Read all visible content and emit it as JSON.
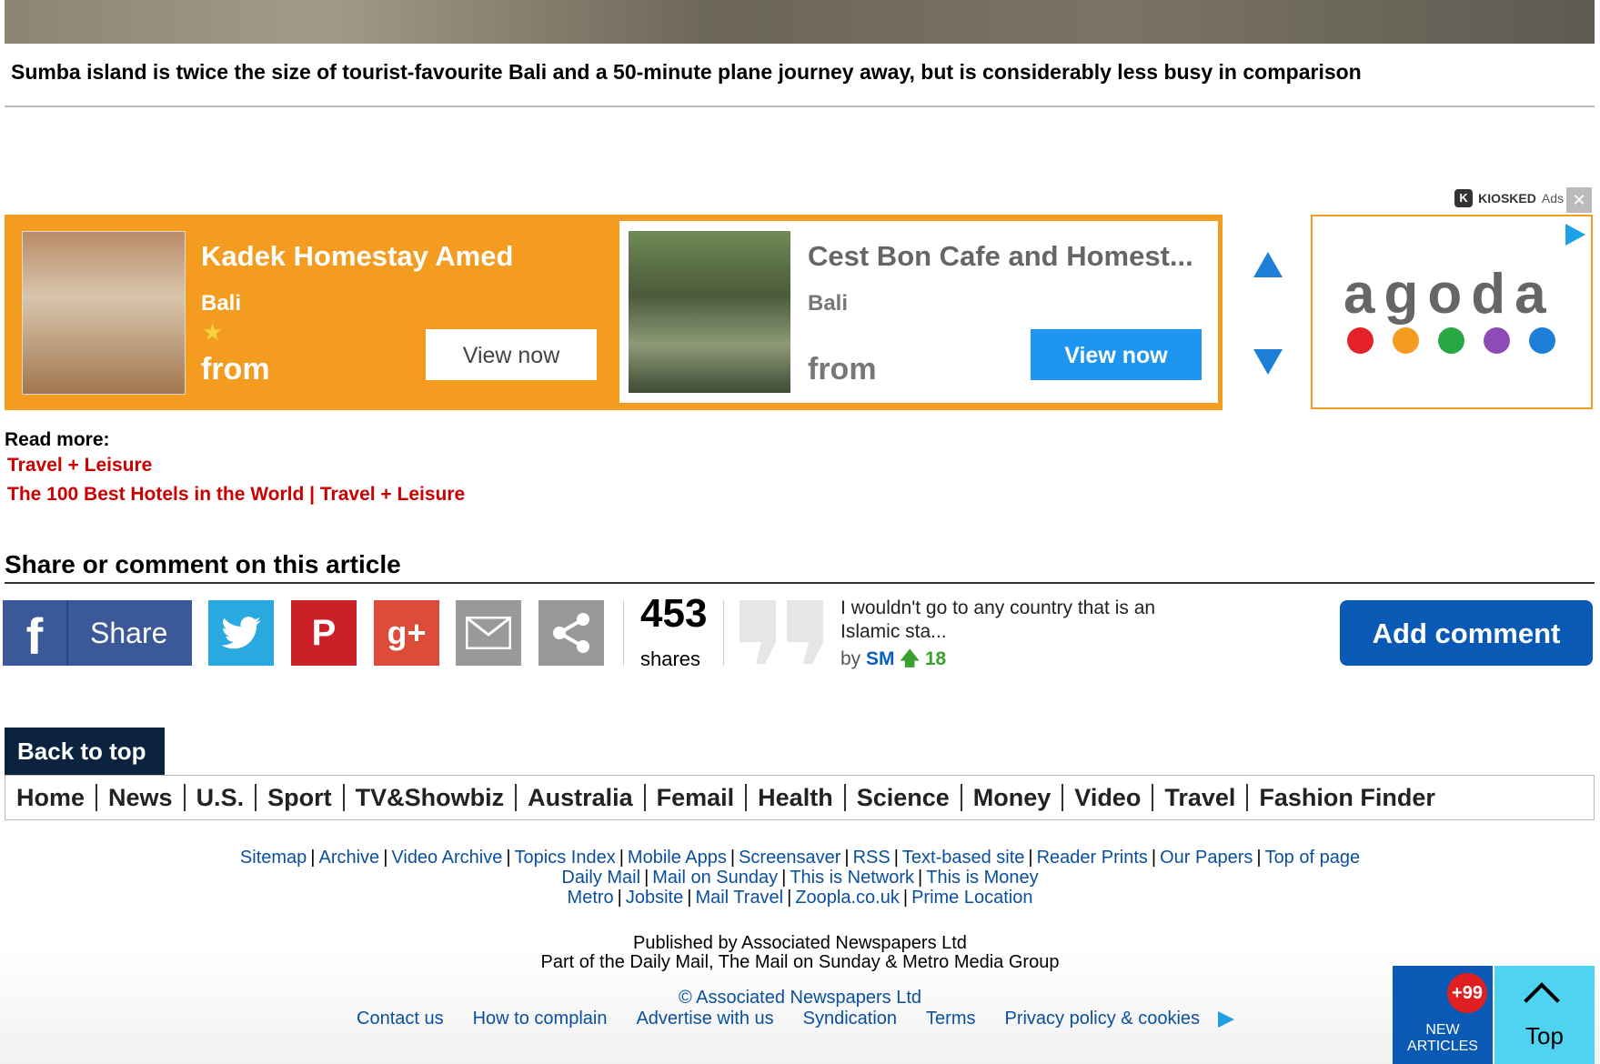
{
  "caption": "Sumba island is twice the size of tourist-favourite Bali and a 50-minute plane journey away, but is considerably less busy in comparison",
  "ad": {
    "provider": "KIOSKED",
    "ads_label": "Ads",
    "close": "✕",
    "cards": [
      {
        "title": "Kadek Homestay Amed",
        "location": "Bali",
        "stars": "★",
        "from": "from",
        "button": "View now"
      },
      {
        "title": "Cest Bon Cafe and Homest...",
        "location": "Bali",
        "from": "from",
        "button": "View now"
      }
    ],
    "brand": "agoda",
    "brand_dot_colors": [
      "#e52128",
      "#f39c1f",
      "#28a745",
      "#8e4bb5",
      "#1e7fd8"
    ]
  },
  "read_more": {
    "label": "Read more:",
    "links": [
      "Travel + Leisure",
      "The 100 Best Hotels in the World | Travel + Leisure"
    ]
  },
  "share": {
    "title": "Share or comment on this article",
    "facebook_label": "Share",
    "count": "453",
    "count_label": "shares",
    "top_comment": "I wouldn't go to any country that is an Islamic sta...",
    "comment_by_prefix": "by",
    "comment_author": "SM",
    "comment_score": "18",
    "add_comment": "Add comment"
  },
  "back_to_top": "Back to top",
  "main_nav": [
    "Home",
    "News",
    "U.S.",
    "Sport",
    "TV&Showbiz",
    "Australia",
    "Femail",
    "Health",
    "Science",
    "Money",
    "Video",
    "Travel",
    "Fashion Finder"
  ],
  "footer": {
    "row1": [
      "Sitemap",
      "Archive",
      "Video Archive",
      "Topics Index",
      "Mobile Apps",
      "Screensaver",
      "RSS",
      "Text-based site",
      "Reader Prints",
      "Our Papers",
      "Top of page"
    ],
    "row2": [
      "Daily Mail",
      "Mail on Sunday",
      "This is Network",
      "This is Money"
    ],
    "row3": [
      "Metro",
      "Jobsite",
      "Mail Travel",
      "Zoopla.co.uk",
      "Prime Location"
    ],
    "published": "Published by Associated Newspapers Ltd",
    "part_of": "Part of the Daily Mail, The Mail on Sunday & Metro Media Group",
    "copyright": "© Associated Newspapers Ltd",
    "bottom_links": [
      "Contact us",
      "How to complain",
      "Advertise with us",
      "Syndication",
      "Terms",
      "Privacy policy & cookies"
    ]
  },
  "widgets": {
    "new_count": "+99",
    "new_label_1": "NEW",
    "new_label_2": "ARTICLES",
    "top_label": "Top"
  }
}
